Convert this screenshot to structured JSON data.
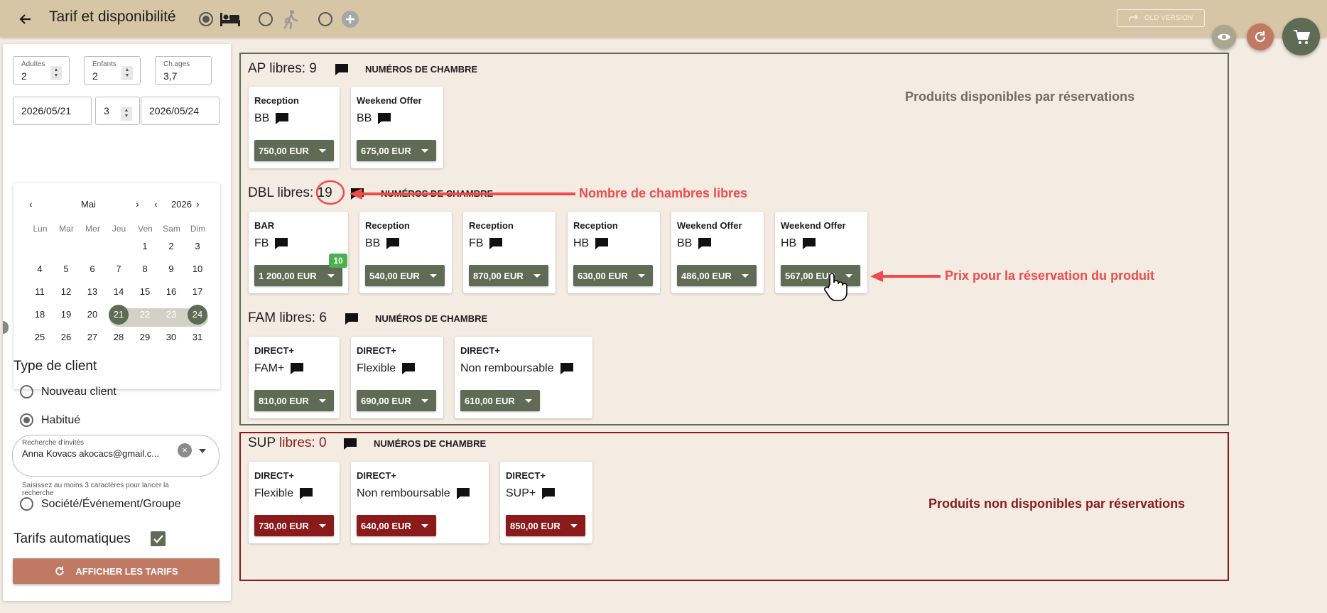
{
  "header": {
    "title": "Tarif et disponibilité",
    "old_version_label": "OLD VERSION"
  },
  "colors": {
    "header_bg": "#d6c6a5",
    "accent_green": "#5f6b55",
    "unavailable_red": "#8b1a1a",
    "button_terracotta": "#c07a63",
    "annotation_red": "#ef4b4b",
    "page_bg": "#f4ebe2"
  },
  "icons": {
    "back": "arrow-left-icon",
    "bed": "bed-icon",
    "walk": "walking-person-icon",
    "add": "add-circle-icon",
    "eye": "eye-icon",
    "refresh": "refresh-icon",
    "cart": "cart-icon",
    "comment": "comment-icon"
  },
  "search": {
    "adults_label": "Adultes",
    "adults_value": "2",
    "children_label": "Enfants",
    "children_value": "2",
    "ages_label": "Ch.ages",
    "ages_value": "3,7",
    "arrival": "2026/05/21",
    "nights": "3",
    "departure": "2026/05/24"
  },
  "calendar": {
    "month": "Mai",
    "year": "2026",
    "weekdays": [
      "Lun",
      "Mar",
      "Mer",
      "Jeu",
      "Ven",
      "Sam",
      "Dim"
    ],
    "weeks": [
      [
        "",
        "",
        "",
        "",
        "1",
        "2",
        "3"
      ],
      [
        "4",
        "5",
        "6",
        "7",
        "8",
        "9",
        "10"
      ],
      [
        "11",
        "12",
        "13",
        "14",
        "15",
        "16",
        "17"
      ],
      [
        "18",
        "19",
        "20",
        "21",
        "22",
        "23",
        "24"
      ],
      [
        "25",
        "26",
        "27",
        "28",
        "29",
        "30",
        "31"
      ]
    ],
    "selected_start": "21",
    "selected_end": "24",
    "in_range": [
      "22",
      "23"
    ]
  },
  "client_type": {
    "title": "Type de client",
    "options": [
      "Nouveau client",
      "Habitué",
      "Société/Événement/Groupe"
    ],
    "selected": "Habitué",
    "guest_search_label": "Recherche d'invités",
    "guest_search_value": "Anna Kovacs akocacs@gmail.c...",
    "hint": "Saisissez au moins 3 caractères pour lancer la recherche"
  },
  "auto_rates": {
    "label": "Tarifs automatiques",
    "checked": true
  },
  "show_rates_label": "AFFICHER LES TARIFS",
  "room_numbers_label": "NUMÉROS DE CHAMBRE",
  "groups": [
    {
      "type": "AP",
      "free_label": "libres:",
      "free": "9",
      "products": [
        {
          "rate": "Reception",
          "board": "BB",
          "price": "750,00 EUR"
        },
        {
          "rate": "Weekend Offer",
          "board": "BB",
          "price": "675,00 EUR"
        }
      ]
    },
    {
      "type": "DBL",
      "free_label": "libres:",
      "free": "19",
      "products": [
        {
          "rate": "BAR",
          "board": "FB",
          "price": "1 200,00 EUR",
          "badge": "10"
        },
        {
          "rate": "Reception",
          "board": "BB",
          "price": "540,00 EUR"
        },
        {
          "rate": "Reception",
          "board": "FB",
          "price": "870,00 EUR"
        },
        {
          "rate": "Reception",
          "board": "HB",
          "price": "630,00 EUR"
        },
        {
          "rate": "Weekend Offer",
          "board": "BB",
          "price": "486,00 EUR"
        },
        {
          "rate": "Weekend Offer",
          "board": "HB",
          "price": "567,00 EUR"
        }
      ]
    },
    {
      "type": "FAM",
      "free_label": "libres:",
      "free": "6",
      "products": [
        {
          "rate": "DIRECT+",
          "board": "FAM+",
          "price": "810,00 EUR"
        },
        {
          "rate": "DIRECT+",
          "board": "Flexible",
          "price": "690,00 EUR"
        },
        {
          "rate": "DIRECT+",
          "board": "Non remboursable",
          "price": "610,00 EUR"
        }
      ]
    },
    {
      "type": "SUP",
      "free_label": "libres:",
      "free": "0",
      "products": [
        {
          "rate": "DIRECT+",
          "board": "Flexible",
          "price": "730,00 EUR"
        },
        {
          "rate": "DIRECT+",
          "board": "Non remboursable",
          "price": "640,00 EUR"
        },
        {
          "rate": "DIRECT+",
          "board": "SUP+",
          "price": "850,00 EUR"
        }
      ]
    }
  ],
  "annotations": {
    "available": "Produits disponibles par réservations",
    "free_rooms": "Nombre de chambres libres",
    "price": "Prix pour la réservation du produit",
    "unavailable": "Produits non disponibles par réservations"
  }
}
